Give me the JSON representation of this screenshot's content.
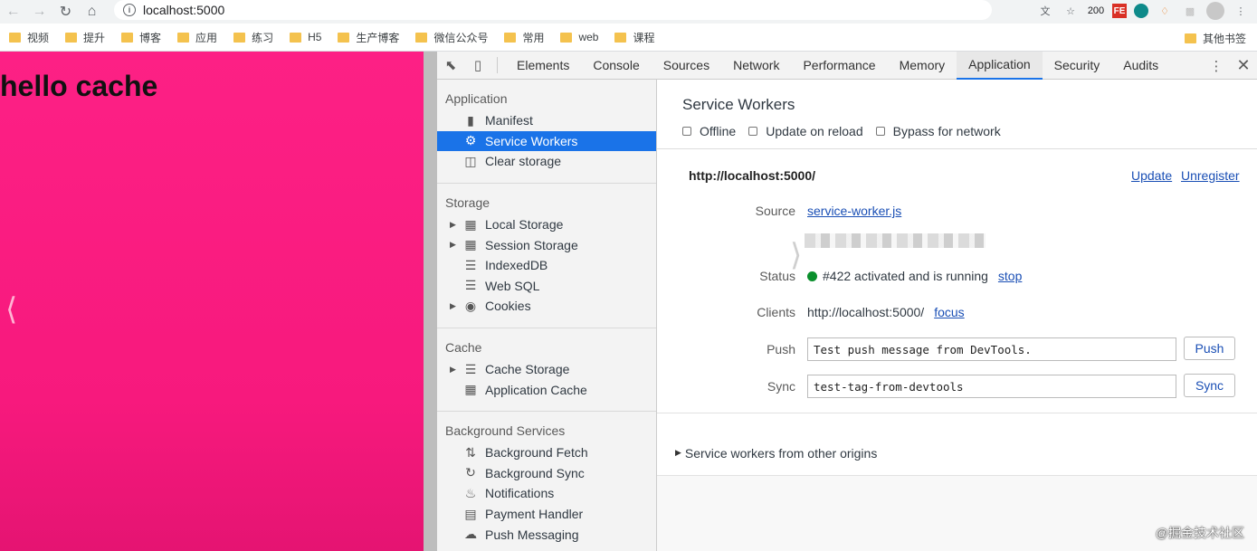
{
  "browser": {
    "url": "localhost:5000",
    "ext_badge": "200",
    "ext_fe": "FE",
    "bookmarks": [
      "视频",
      "提升",
      "博客",
      "应用",
      "练习",
      "H5",
      "生产博客",
      "微信公众号",
      "常用",
      "web",
      "课程"
    ],
    "bookmarks_other": "其他书签"
  },
  "page": {
    "heading": "hello cache",
    "bg_color": "#fd2085"
  },
  "devtools": {
    "tabs": [
      "Elements",
      "Console",
      "Sources",
      "Network",
      "Performance",
      "Memory",
      "Application",
      "Security",
      "Audits"
    ],
    "active_tab": "Application",
    "accent": "#1a73e8",
    "sidebar": {
      "application": {
        "title": "Application",
        "items": [
          {
            "label": "Manifest",
            "icon": "file-icon"
          },
          {
            "label": "Service Workers",
            "icon": "gear-icon",
            "selected": true
          },
          {
            "label": "Clear storage",
            "icon": "trash-icon"
          }
        ]
      },
      "storage": {
        "title": "Storage",
        "items": [
          {
            "label": "Local Storage",
            "icon": "grid-icon",
            "expandable": true
          },
          {
            "label": "Session Storage",
            "icon": "grid-icon",
            "expandable": true
          },
          {
            "label": "IndexedDB",
            "icon": "database-icon"
          },
          {
            "label": "Web SQL",
            "icon": "database-icon"
          },
          {
            "label": "Cookies",
            "icon": "cookie-icon",
            "expandable": true
          }
        ]
      },
      "cache": {
        "title": "Cache",
        "items": [
          {
            "label": "Cache Storage",
            "icon": "database-icon",
            "expandable": true
          },
          {
            "label": "Application Cache",
            "icon": "grid-icon"
          }
        ]
      },
      "background": {
        "title": "Background Services",
        "items": [
          {
            "label": "Background Fetch",
            "icon": "arrows-icon"
          },
          {
            "label": "Background Sync",
            "icon": "sync-icon"
          },
          {
            "label": "Notifications",
            "icon": "bell-icon"
          },
          {
            "label": "Payment Handler",
            "icon": "card-icon"
          },
          {
            "label": "Push Messaging",
            "icon": "cloud-icon"
          }
        ]
      }
    },
    "main": {
      "title": "Service Workers",
      "options": [
        "Offline",
        "Update on reload",
        "Bypass for network"
      ],
      "origin": "http://localhost:5000/",
      "update_label": "Update",
      "unregister_label": "Unregister",
      "source_label": "Source",
      "source_link": "service-worker.js",
      "status_label": "Status",
      "status_text": "#422 activated and is running",
      "status_color": "#0a8f2c",
      "stop_label": "stop",
      "clients_label": "Clients",
      "clients_value": "http://localhost:5000/",
      "focus_label": "focus",
      "push_label": "Push",
      "push_value": "Test push message from DevTools.",
      "push_button": "Push",
      "sync_label": "Sync",
      "sync_value": "test-tag-from-devtools",
      "sync_button": "Sync",
      "other_origins": "Service workers from other origins"
    }
  },
  "watermark": "@掘金技术社区"
}
